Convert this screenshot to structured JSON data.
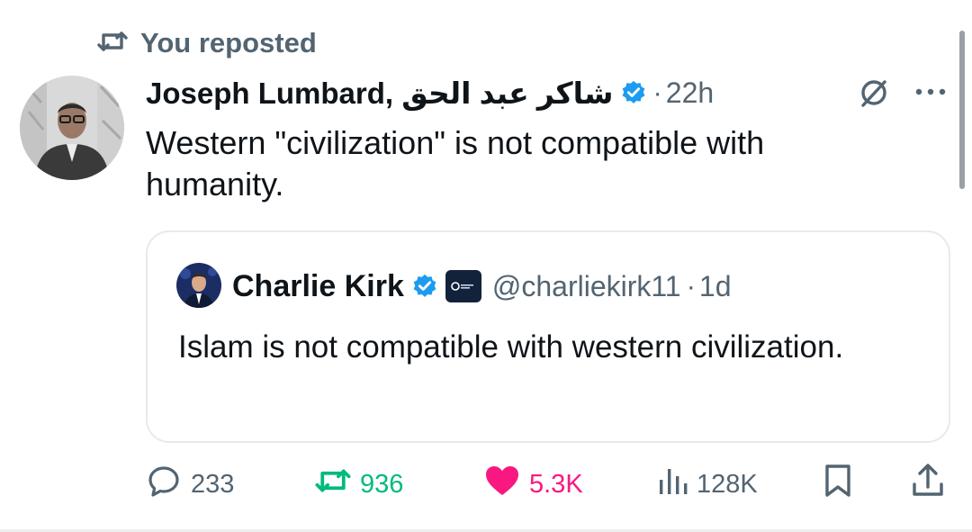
{
  "repost": {
    "label": "You reposted",
    "icon": "repost-icon"
  },
  "tweet": {
    "author_name": "Joseph Lumbard, شاكر عبد الحق",
    "verified": true,
    "separator": "·",
    "time": "22h",
    "text": "Western \"civilization\" is not compatible with humanity."
  },
  "quoted": {
    "author_name": "Charlie Kirk",
    "verified": true,
    "affiliation_badge": "company-badge",
    "handle": "@charliekirk11",
    "separator": "·",
    "time": "1d",
    "text": "Islam is not compatible with western civilization."
  },
  "actions": {
    "replies": "233",
    "reposts": "936",
    "likes": "5.3K",
    "views": "128K"
  },
  "colors": {
    "verified_blue": "#1d9bf0",
    "repost_green": "#00ba7c",
    "like_pink": "#f91880",
    "secondary_text": "#536471"
  }
}
